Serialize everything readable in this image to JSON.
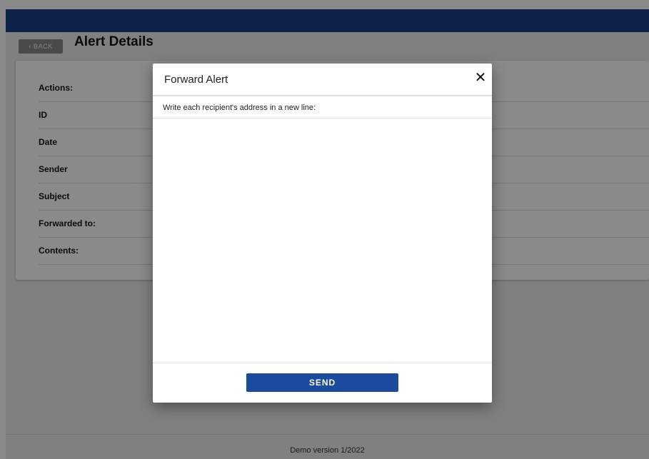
{
  "header": {
    "back_label": "BACK",
    "back_icon": "chevron-left-icon",
    "title": "Alert Details"
  },
  "details": {
    "rows": [
      {
        "label": "Actions:"
      },
      {
        "label": "ID"
      },
      {
        "label": "Date"
      },
      {
        "label": "Sender"
      },
      {
        "label": "Subject"
      },
      {
        "label": "Forwarded to:"
      },
      {
        "label": "Contents:"
      }
    ]
  },
  "footer": {
    "version": "Demo version 1/2022"
  },
  "modal": {
    "title": "Forward Alert",
    "close_icon": "close-icon",
    "instruction": "Write each recipient's address in a new line:",
    "recipients_value": "",
    "send_label": "SEND"
  },
  "colors": {
    "topbar": "#1c3f8a",
    "send_button": "#1c4a9c",
    "back_button": "#8a8a8a",
    "overlay": "rgba(0,0,0,0.46)"
  }
}
